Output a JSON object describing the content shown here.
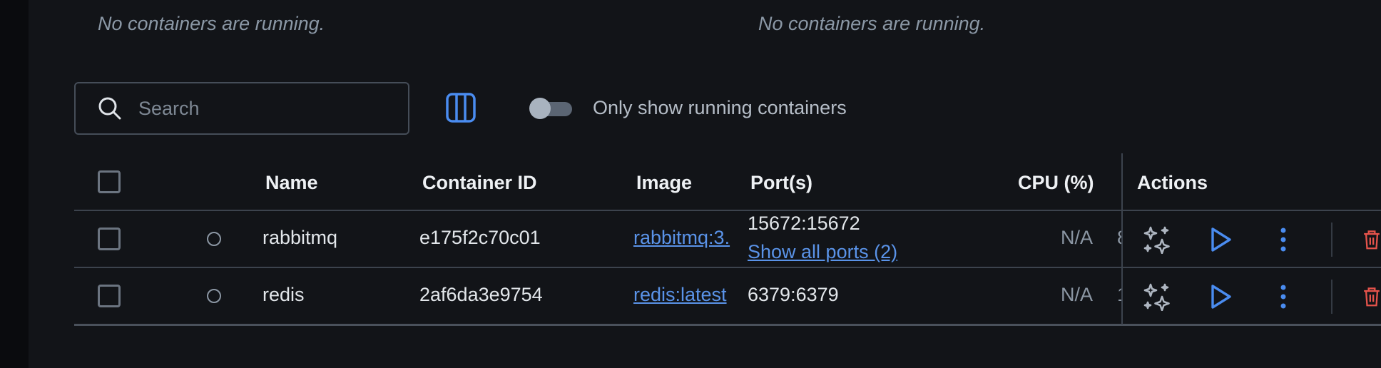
{
  "panels": {
    "left_empty": "No containers are running.",
    "right_empty": "No containers are running."
  },
  "search": {
    "placeholder": "Search",
    "value": ""
  },
  "toggle": {
    "label": "Only show running containers",
    "on": false
  },
  "table": {
    "columns": {
      "name": "Name",
      "container_id": "Container ID",
      "image": "Image",
      "ports": "Port(s)",
      "cpu": "CPU (%)",
      "actions": "Actions"
    },
    "rows": [
      {
        "name": "rabbitmq",
        "container_id": "e175f2c70c01",
        "image": "rabbitmq:3.",
        "port": "15672:15672",
        "ports_link": "Show all ports (2)",
        "cpu": "N/A",
        "next_col": "8"
      },
      {
        "name": "redis",
        "container_id": "2af6da3e9754",
        "image": "redis:latest",
        "port": "6379:6379",
        "cpu": "N/A",
        "next_col": "1"
      }
    ]
  },
  "colors": {
    "background": "#121418",
    "accent": "#4a8cf0",
    "danger": "#e5534b",
    "muted": "#8b96a3"
  },
  "icons": {
    "columns": "columns-icon",
    "ai": "sparkles-icon",
    "start": "play-icon",
    "more": "kebab-icon",
    "delete": "trash-icon",
    "search": "search-icon"
  }
}
